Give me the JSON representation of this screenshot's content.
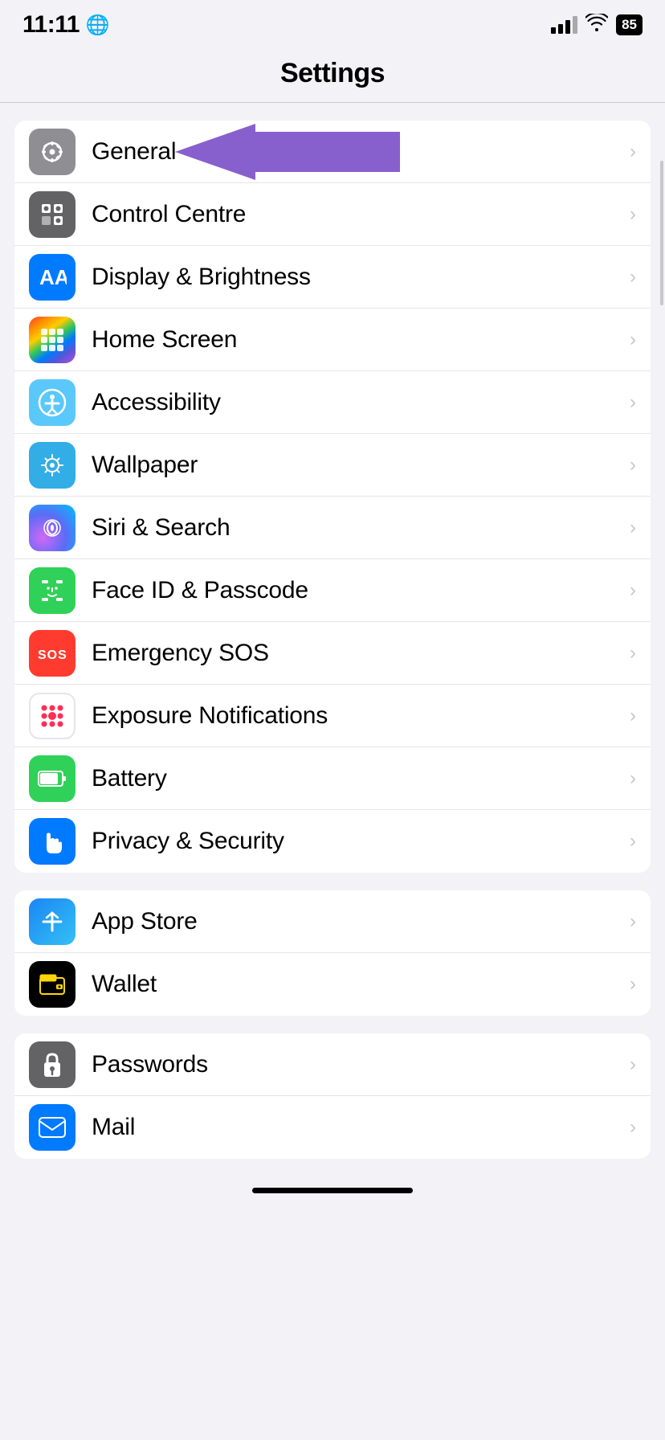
{
  "statusBar": {
    "time": "11:11",
    "battery": "85"
  },
  "header": {
    "title": "Settings"
  },
  "groups": [
    {
      "id": "system",
      "items": [
        {
          "id": "general",
          "label": "General",
          "iconType": "gear",
          "iconBg": "gray",
          "hasArrow": true
        },
        {
          "id": "control-centre",
          "label": "Control Centre",
          "iconType": "toggles",
          "iconBg": "dark-gray",
          "hasArrow": true
        },
        {
          "id": "display-brightness",
          "label": "Display & Brightness",
          "iconType": "aa",
          "iconBg": "blue",
          "hasArrow": true
        },
        {
          "id": "home-screen",
          "label": "Home Screen",
          "iconType": "grid",
          "iconBg": "multicolor",
          "hasArrow": true
        },
        {
          "id": "accessibility",
          "label": "Accessibility",
          "iconType": "person-circle",
          "iconBg": "light-blue",
          "hasArrow": true
        },
        {
          "id": "wallpaper",
          "label": "Wallpaper",
          "iconType": "flower",
          "iconBg": "teal",
          "hasArrow": true
        },
        {
          "id": "siri-search",
          "label": "Siri & Search",
          "iconType": "siri",
          "iconBg": "siri",
          "hasArrow": true
        },
        {
          "id": "face-id",
          "label": "Face ID & Passcode",
          "iconType": "face-id",
          "iconBg": "green",
          "hasArrow": true
        },
        {
          "id": "emergency-sos",
          "label": "Emergency SOS",
          "iconType": "sos",
          "iconBg": "red",
          "hasArrow": true
        },
        {
          "id": "exposure",
          "label": "Exposure Notifications",
          "iconType": "dots",
          "iconBg": "white",
          "hasArrow": true
        },
        {
          "id": "battery",
          "label": "Battery",
          "iconType": "battery",
          "iconBg": "green",
          "hasArrow": true
        },
        {
          "id": "privacy-security",
          "label": "Privacy & Security",
          "iconType": "hand",
          "iconBg": "blue-hand",
          "hasArrow": true
        }
      ]
    },
    {
      "id": "apps1",
      "items": [
        {
          "id": "app-store",
          "label": "App Store",
          "iconType": "appstore",
          "iconBg": "appstore",
          "hasArrow": true
        },
        {
          "id": "wallet",
          "label": "Wallet",
          "iconType": "wallet",
          "iconBg": "wallet",
          "hasArrow": true
        }
      ]
    },
    {
      "id": "apps2",
      "items": [
        {
          "id": "passwords",
          "label": "Passwords",
          "iconType": "key",
          "iconBg": "passwords",
          "hasArrow": true
        },
        {
          "id": "mail",
          "label": "Mail",
          "iconType": "mail",
          "iconBg": "mail",
          "hasArrow": true
        }
      ]
    }
  ]
}
